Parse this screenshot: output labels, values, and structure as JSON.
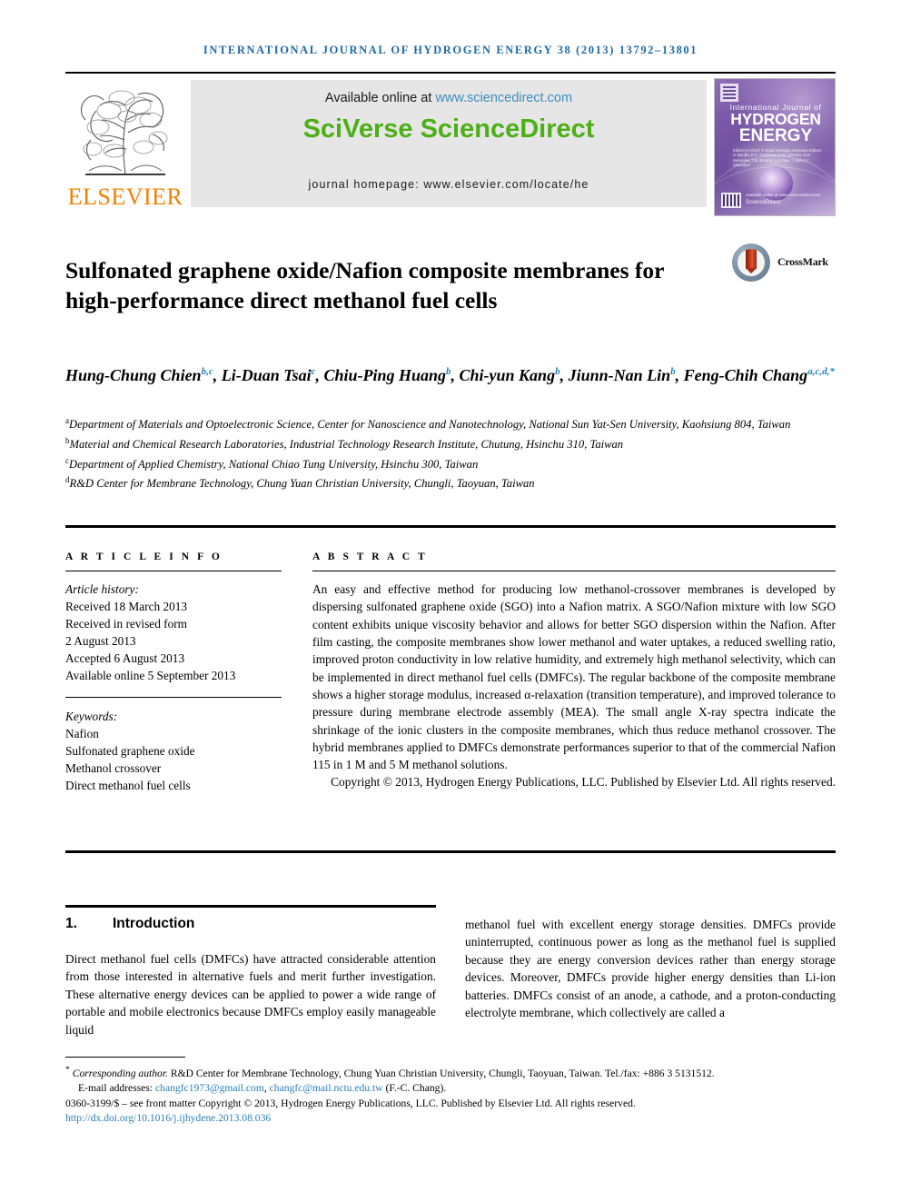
{
  "running_head": "International Journal of Hydrogen Energy 38 (2013) 13792–13801",
  "masthead": {
    "publisher_name": "ELSEVIER",
    "publisher_logo_icon": "elsevier-tree-icon",
    "available_prefix": "Available online at ",
    "available_link": "www.sciencedirect.com",
    "brand": "SciVerse ScienceDirect",
    "homepage": "journal homepage: www.elsevier.com/locate/he",
    "cover": {
      "overline": "International Journal of",
      "line1": "HYDROGEN",
      "line2": "ENERGY",
      "editors": "Editors-in-Chief: T. Nejat Veziroglu  Associate Editors: S. Bonilla, E.C. Cardenas, H.M. Liberato, M.D. Hasselius, J.M. Bockris, L.A. Das, T. and A.V. Sitaradjan",
      "footer_brand": "ScienceDirect",
      "footer_tiny": "Available online at www.sciencedirect.com"
    }
  },
  "article": {
    "title": "Sulfonated graphene oxide/Nafion composite membranes for high-performance direct methanol fuel cells",
    "crossmark_label": "CrossMark",
    "authors_line1": "Hung-Chung Chien",
    "authors": [
      {
        "name": "Hung-Chung Chien",
        "marks": "b,c"
      },
      {
        "name": "Li-Duan Tsai",
        "marks": "c"
      },
      {
        "name": "Chiu-Ping Huang",
        "marks": "b"
      },
      {
        "name": "Chi-yun Kang",
        "marks": "b"
      },
      {
        "name": "Jiunn-Nan Lin",
        "marks": "b"
      },
      {
        "name": "Feng-Chih Chang",
        "marks": "a,c,d,*"
      }
    ],
    "affiliations": [
      {
        "mark": "a",
        "text": "Department of Materials and Optoelectronic Science, Center for Nanoscience and Nanotechnology, National Sun Yat-Sen University, Kaohsiung 804, Taiwan"
      },
      {
        "mark": "b",
        "text": "Material and Chemical Research Laboratories, Industrial Technology Research Institute, Chutung, Hsinchu 310, Taiwan"
      },
      {
        "mark": "c",
        "text": "Department of Applied Chemistry, National Chiao Tung University, Hsinchu 300, Taiwan"
      },
      {
        "mark": "d",
        "text": "R&D Center for Membrane Technology, Chung Yuan Christian University, Chungli, Taoyuan, Taiwan"
      }
    ]
  },
  "info": {
    "section_label": "A R T I C L E   I N F O",
    "history_label": "Article history:",
    "history": [
      "Received 18 March 2013",
      "Received in revised form",
      "2 August 2013",
      "Accepted 6 August 2013",
      "Available online 5 September 2013"
    ],
    "keywords_label": "Keywords:",
    "keywords": [
      "Nafion",
      "Sulfonated graphene oxide",
      "Methanol crossover",
      "Direct methanol fuel cells"
    ]
  },
  "abstract": {
    "section_label": "A B S T R A C T",
    "body": "An easy and effective method for producing low methanol-crossover membranes is developed by dispersing sulfonated graphene oxide (SGO) into a Nafion matrix. A SGO/Nafion mixture with low SGO content exhibits unique viscosity behavior and allows for better SGO dispersion within the Nafion. After film casting, the composite membranes show lower methanol and water uptakes, a reduced swelling ratio, improved proton conductivity in low relative humidity, and extremely high methanol selectivity, which can be implemented in direct methanol fuel cells (DMFCs). The regular backbone of the composite membrane shows a higher storage modulus, increased α-relaxation (transition temperature), and improved tolerance to pressure during membrane electrode assembly (MEA). The small angle X-ray spectra indicate the shrinkage of the ionic clusters in the composite membranes, which thus reduce methanol crossover. The hybrid membranes applied to DMFCs demonstrate performances superior to that of the commercial Nafion 115 in 1 M and 5 M methanol solutions.",
    "copyright": "Copyright © 2013, Hydrogen Energy Publications, LLC. Published by Elsevier Ltd. All rights reserved."
  },
  "introduction": {
    "number": "1.",
    "heading": "Introduction",
    "column_left": "Direct methanol fuel cells (DMFCs) have attracted considerable attention from those interested in alternative fuels and merit further investigation. These alternative energy devices can be applied to power a wide range of portable and mobile electronics because DMFCs employ easily manageable liquid",
    "column_right": "methanol fuel with excellent energy storage densities. DMFCs provide uninterrupted, continuous power as long as the methanol fuel is supplied because they are energy conversion devices rather than energy storage devices. Moreover, DMFCs provide higher energy densities than Li-ion batteries. DMFCs consist of an anode, a cathode, and a proton-conducting electrolyte membrane, which collectively are called a"
  },
  "footer": {
    "corresponding_marker": "*",
    "corresponding_label": "Corresponding author.",
    "corresponding_rest": " R&D Center for Membrane Technology, Chung Yuan Christian University, Chungli, Taoyuan, Taiwan. Tel./fax: +886 3 5131512.",
    "email_label": "E-mail addresses:",
    "email_1": "changfc1973@gmail.com",
    "email_2": "changfc@mail.nctu.edu.tw",
    "email_suffix": " (F.-C. Chang).",
    "issn_line": "0360-3199/$ – see front matter Copyright © 2013, Hydrogen Energy Publications, LLC. Published by Elsevier Ltd. All rights reserved.",
    "doi": "http://dx.doi.org/10.1016/j.ijhydene.2013.08.036"
  },
  "colors": {
    "running_head": "#1f6aa8",
    "link": "#3a8fbf",
    "sciencedirect_green": "#4caf16",
    "elsevier_orange": "#f08000",
    "affiliation_mark": "#1f7fb5"
  }
}
